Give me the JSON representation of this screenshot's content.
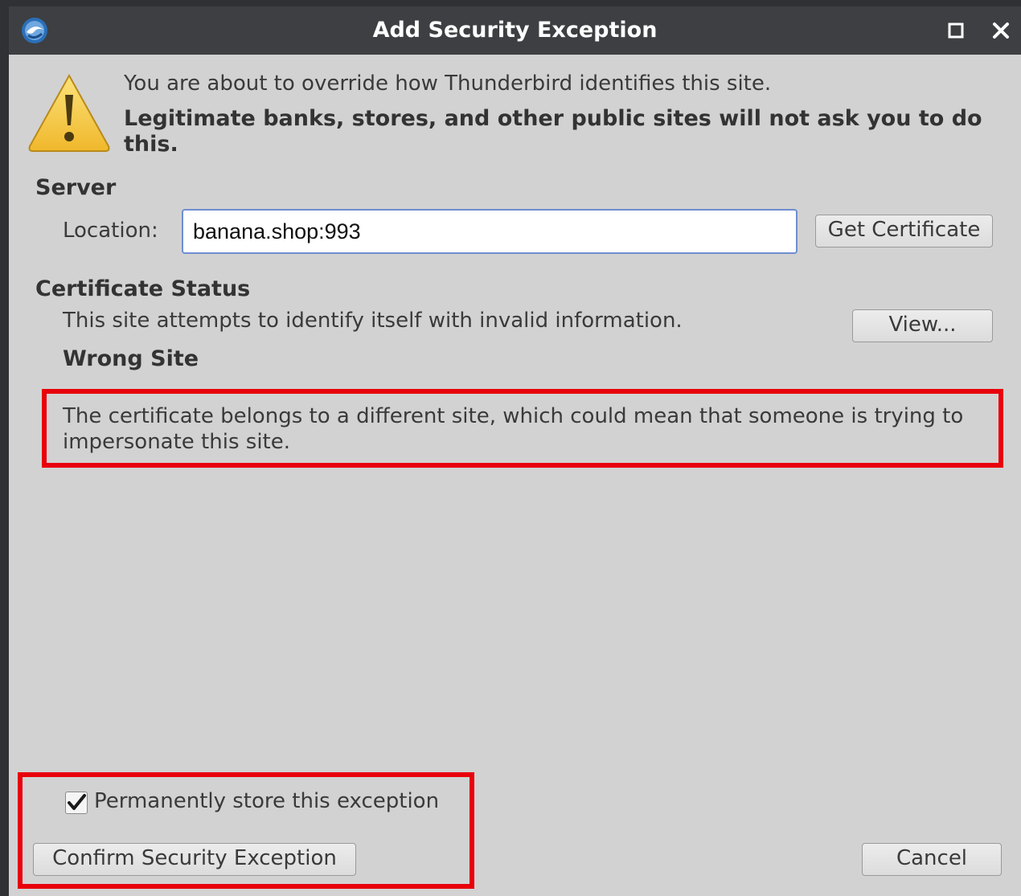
{
  "window": {
    "title": "Add Security Exception"
  },
  "warning": {
    "intro": "You are about to override how Thunderbird identifies this site.",
    "bold_text": "Legitimate banks, stores, and other public sites will not ask you to do this."
  },
  "server": {
    "heading": "Server",
    "location_label": "Location:",
    "location_value": "banana.shop:993",
    "get_certificate_label": "Get Certificate"
  },
  "certificate_status": {
    "heading": "Certificate Status",
    "status_text": "This site attempts to identify itself with invalid information.",
    "view_label": "View...",
    "problem_title": "Wrong Site",
    "problem_detail": "The certificate belongs to a different site, which could mean that someone is trying to impersonate this site."
  },
  "footer": {
    "permanent_label": "Permanently store this exception",
    "permanent_checked": true,
    "confirm_label": "Confirm Security Exception",
    "cancel_label": "Cancel"
  },
  "colors": {
    "highlight": "#e8000b",
    "titlebar": "#3d3f42",
    "dialog_bg": "#d2d2d2"
  },
  "icons": {
    "app": "thunderbird-icon",
    "warning": "warning-triangle-icon",
    "maximize": "maximize-icon",
    "close": "close-icon",
    "check": "checkmark-icon"
  }
}
